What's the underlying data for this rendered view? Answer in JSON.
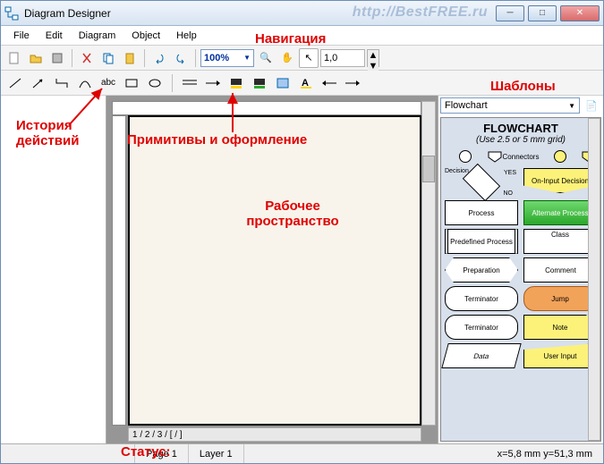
{
  "window": {
    "title": "Diagram Designer",
    "watermark": "http://BestFREE.ru"
  },
  "menu": {
    "file": "File",
    "edit": "Edit",
    "diagram": "Diagram",
    "object": "Object",
    "help": "Help"
  },
  "toolbar": {
    "zoom": "100%",
    "line_weight": "1,0"
  },
  "templates": {
    "selected": "Flowchart",
    "title": "FLOWCHART",
    "subtitle": "(Use 2.5 or 5 mm grid)",
    "connectors": "Connectors",
    "decision": "Decision",
    "yes": "YES",
    "no": "NO",
    "on_input": "On-Input Decision",
    "process": "Process",
    "alt_process": "Alternate Process",
    "predef": "Predefined Process",
    "class": "Class",
    "prep": "Preparation",
    "comment": "Comment",
    "term1": "Terminator",
    "jump": "Jump",
    "term2": "Terminator",
    "note": "Note",
    "data": "Data",
    "user_input": "User Input"
  },
  "status": {
    "page": "Page 1",
    "layer": "Layer 1",
    "coords": "x=5,8 mm  y=51,3 mm"
  },
  "pages_tabs": "1 / 2 / 3 / [ / ]",
  "annotations": {
    "nav": "Навигация",
    "history": "История действий",
    "primitives": "Примитивы и оформление",
    "workspace": "Рабочее пространство",
    "templates": "Шаблоны",
    "status": "Статус:"
  }
}
